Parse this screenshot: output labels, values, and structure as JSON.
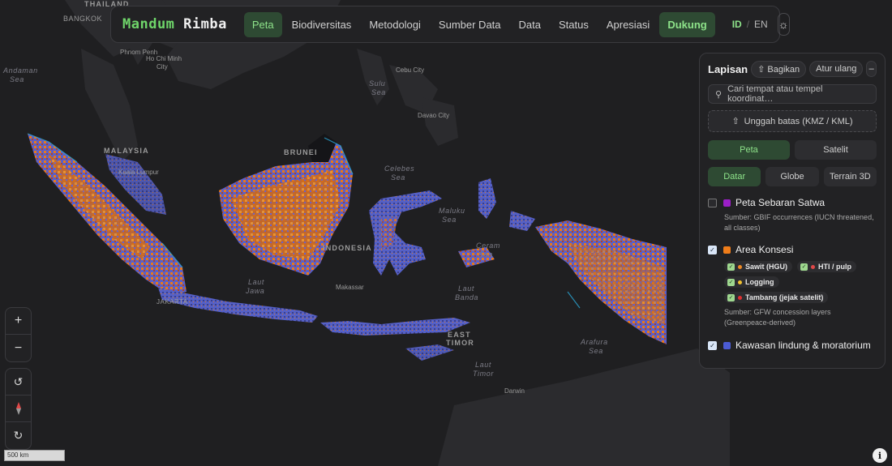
{
  "brand": {
    "part1": "Mandum",
    "part2": "Rimba"
  },
  "nav": {
    "items": [
      "Peta",
      "Biodiversitas",
      "Metodologi",
      "Sumber Data",
      "Data",
      "Status",
      "Apresiasi"
    ],
    "support": "Dukung",
    "lang_id": "ID",
    "lang_sep": "/",
    "lang_en": "EN",
    "theme_icon": "sun-icon"
  },
  "layers": {
    "title": "Lapisan",
    "share": "Bagikan",
    "share_icon": "share-icon",
    "reset": "Atur ulang",
    "collapse": "–",
    "search_placeholder": "Cari tempat atau tempel koordinat…",
    "upload": "Unggah batas (KMZ / KML)",
    "basemap": [
      "Peta",
      "Satelit"
    ],
    "views": [
      "Datar",
      "Globe",
      "Terrain 3D"
    ],
    "list": [
      {
        "name": "Peta Sebaran Satwa",
        "color": "#9b1fc6",
        "checked": false,
        "source": "Sumber: GBIF occurrences (IUCN threatened, all classes)"
      },
      {
        "name": "Area Konsesi",
        "color": "#ef7d1a",
        "checked": true,
        "source": "Sumber: GFW concession layers (Greenpeace-derived)",
        "subs": [
          {
            "label": "Sawit (HGU)",
            "dot": "#f08a24"
          },
          {
            "label": "HTI / pulp",
            "dot": "#e04848"
          },
          {
            "label": "Logging",
            "dot": "#f2c230"
          },
          {
            "label": "Tambang (jejak satelit)",
            "dot": "#e03030"
          }
        ]
      },
      {
        "name": "Kawasan lindung & moratorium",
        "color": "#4b5bd4",
        "checked": true
      }
    ]
  },
  "controls": {
    "zoom_in": "+",
    "zoom_out": "−",
    "rotate_left": "↺",
    "compass": "compass-icon",
    "rotate_right": "↻"
  },
  "scale": "500 km",
  "info": "i",
  "map_labels": {
    "thailand": "THAILAND",
    "bangkok": "BANGKOK",
    "phnom_penh": "Phnom Penh",
    "hcmc_1": "Ho Chi Minh",
    "hcmc_2": "City",
    "andaman_1": "Andaman",
    "andaman_2": "Sea",
    "malaysia": "MALAYSIA",
    "kuala_lumpur": "Kuala Lumpur",
    "brunei": "BRUNEI",
    "cebu": "Cebu City",
    "davao": "Davao City",
    "sulu_1": "Sulu",
    "sulu_2": "Sea",
    "celebes_1": "Celebes",
    "celebes_2": "Sea",
    "maluku_1": "Maluku",
    "maluku_2": "Sea",
    "ceram_1": "Ceram",
    "ceram_2": "Sea",
    "indonesia": "INDONESIA",
    "jawa_1": "Laut",
    "jawa_2": "Jawa",
    "banda_1": "Laut",
    "banda_2": "Banda",
    "makassar": "Makassar",
    "jakarta": "JAKARTA",
    "east_timor_1": "EAST",
    "east_timor_2": "TIMOR",
    "arafura_1": "Arafura",
    "arafura_2": "Sea",
    "laut_timor_1": "Laut",
    "laut_timor_2": "Timor",
    "darwin": "Darwin"
  }
}
